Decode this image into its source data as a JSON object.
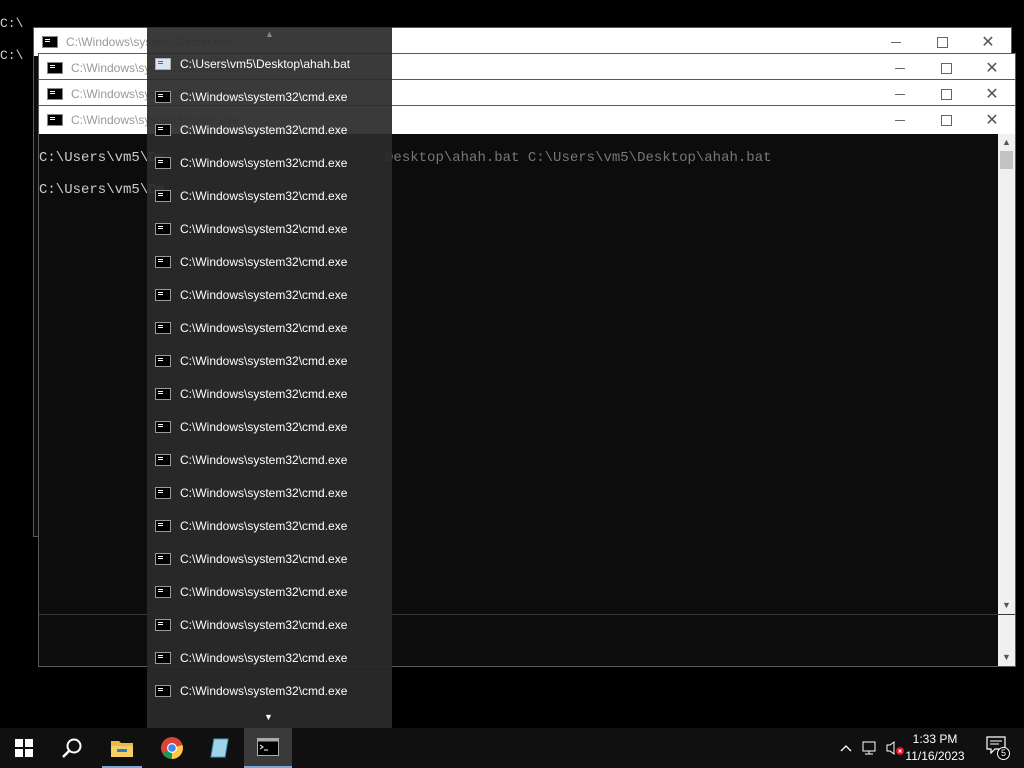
{
  "background_console": {
    "line1": "C:\\",
    "line2": "C:\\"
  },
  "windows": [
    {
      "title": "C:\\Windows\\system32\\cmd.exe"
    },
    {
      "title": "C:\\Windows\\system32\\cmd.exe"
    },
    {
      "title": "C:\\Windows\\system32\\cmd.exe"
    },
    {
      "title": "C:\\Windows\\system32\\cmd.exe"
    }
  ],
  "active_console": {
    "line1_left": "C:\\Users\\vm5\\De",
    "line1_right": "Desktop\\ahah.bat C:\\Users\\vm5\\Desktop\\ahah.bat",
    "line2_left": "C:\\Users\\vm5\\De"
  },
  "jump_list": {
    "items": [
      "C:\\Users\\vm5\\Desktop\\ahah.bat",
      "C:\\Windows\\system32\\cmd.exe",
      "C:\\Windows\\system32\\cmd.exe",
      "C:\\Windows\\system32\\cmd.exe",
      "C:\\Windows\\system32\\cmd.exe",
      "C:\\Windows\\system32\\cmd.exe",
      "C:\\Windows\\system32\\cmd.exe",
      "C:\\Windows\\system32\\cmd.exe",
      "C:\\Windows\\system32\\cmd.exe",
      "C:\\Windows\\system32\\cmd.exe",
      "C:\\Windows\\system32\\cmd.exe",
      "C:\\Windows\\system32\\cmd.exe",
      "C:\\Windows\\system32\\cmd.exe",
      "C:\\Windows\\system32\\cmd.exe",
      "C:\\Windows\\system32\\cmd.exe",
      "C:\\Windows\\system32\\cmd.exe",
      "C:\\Windows\\system32\\cmd.exe",
      "C:\\Windows\\system32\\cmd.exe",
      "C:\\Windows\\system32\\cmd.exe",
      "C:\\Windows\\system32\\cmd.exe"
    ]
  },
  "taskbar": {
    "time": "1:33 PM",
    "date": "11/16/2023",
    "notification_count": "5",
    "icons": [
      "windows-start-icon",
      "search-icon",
      "file-explorer-icon",
      "chrome-icon",
      "notepad-icon",
      "cmd-icon"
    ]
  },
  "colors": {
    "taskbar_bg": "#101010",
    "accent": "#7aa7d6",
    "popup_bg": "#2b2b2b",
    "console_bg": "#0c0c0c"
  }
}
